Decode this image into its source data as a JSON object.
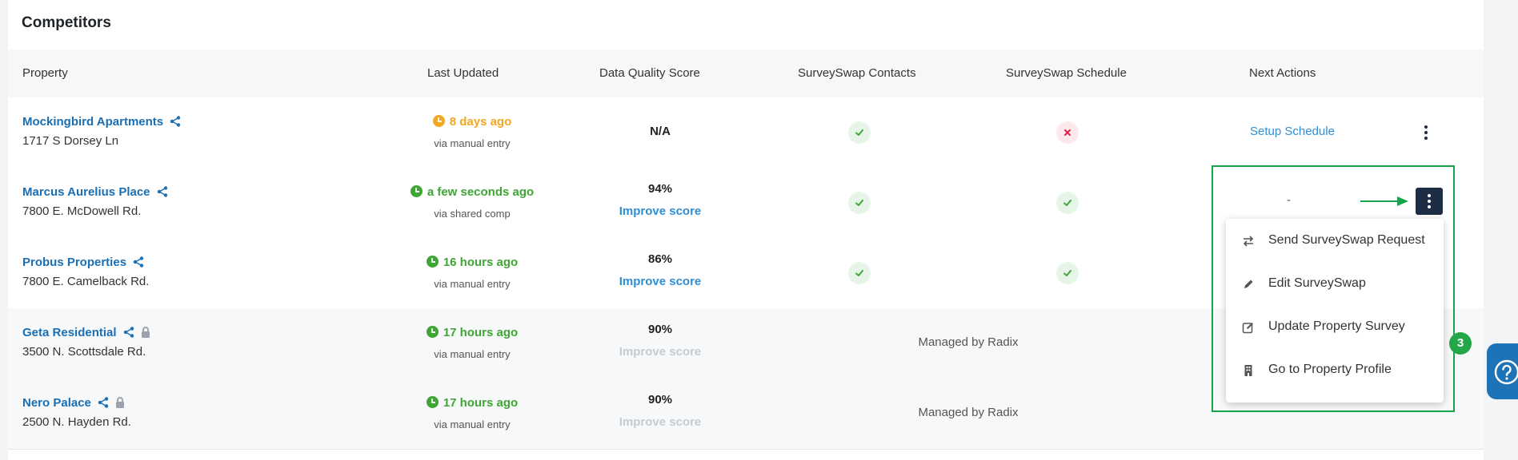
{
  "section": {
    "title": "Competitors"
  },
  "columns": [
    "Property",
    "Last Updated",
    "Data Quality Score",
    "SurveySwap Contacts",
    "SurveySwap Schedule",
    "Next Actions"
  ],
  "rows": [
    {
      "name": "Mockingbird Apartments",
      "address": "1717 S Dorsey Ln",
      "shared": true,
      "locked": false,
      "updated": "8 days ago",
      "updated_color": "#f5a623",
      "via": "via manual entry",
      "score": "N/A",
      "improve": "",
      "contacts": "check",
      "schedule": "x",
      "next_action": "Setup Schedule",
      "managed": ""
    },
    {
      "name": "Marcus Aurelius Place",
      "address": "7800 E. McDowell Rd.",
      "shared": true,
      "locked": false,
      "updated": "a few seconds ago",
      "updated_color": "#3fa535",
      "via": "via shared comp",
      "score": "94%",
      "improve": "Improve score",
      "contacts": "check",
      "schedule": "check",
      "next_action": "-",
      "managed": ""
    },
    {
      "name": "Probus Properties",
      "address": "7800 E. Camelback Rd.",
      "shared": true,
      "locked": false,
      "updated": "16 hours ago",
      "updated_color": "#3fa535",
      "via": "via manual entry",
      "score": "86%",
      "improve": "Improve score",
      "contacts": "check",
      "schedule": "check",
      "next_action": "",
      "managed": ""
    },
    {
      "name": "Geta Residential",
      "address": "3500 N. Scottsdale Rd.",
      "shared": true,
      "locked": true,
      "updated": "17 hours ago",
      "updated_color": "#3fa535",
      "via": "via manual entry",
      "score": "90%",
      "improve": "Improve score",
      "improve_disabled": true,
      "managed": "Managed by Radix",
      "next_action": ""
    },
    {
      "name": "Nero Palace",
      "address": "2500 N. Hayden Rd.",
      "shared": true,
      "locked": true,
      "updated": "17 hours ago",
      "updated_color": "#3fa535",
      "via": "via manual entry",
      "score": "90%",
      "improve": "Improve score",
      "improve_disabled": true,
      "managed": "Managed by Radix",
      "next_action": "-"
    }
  ],
  "dropdown": {
    "items": [
      {
        "label": "Send SurveySwap Request",
        "icon": "swap-arrows-icon"
      },
      {
        "label": "Edit SurveySwap",
        "icon": "pencil-icon"
      },
      {
        "label": "Update Property Survey",
        "icon": "edit-box-icon"
      },
      {
        "label": "Go to Property Profile",
        "icon": "building-icon"
      }
    ]
  },
  "help": {
    "badge_count": "3",
    "icon": "question-icon"
  },
  "colors": {
    "link": "#1a6fb4",
    "accent_blue": "#2d8fd5",
    "success": "#3fa535",
    "warning": "#f5a623",
    "danger": "#e0204a",
    "navy": "#1c2d45",
    "highlight": "#17a34a"
  }
}
